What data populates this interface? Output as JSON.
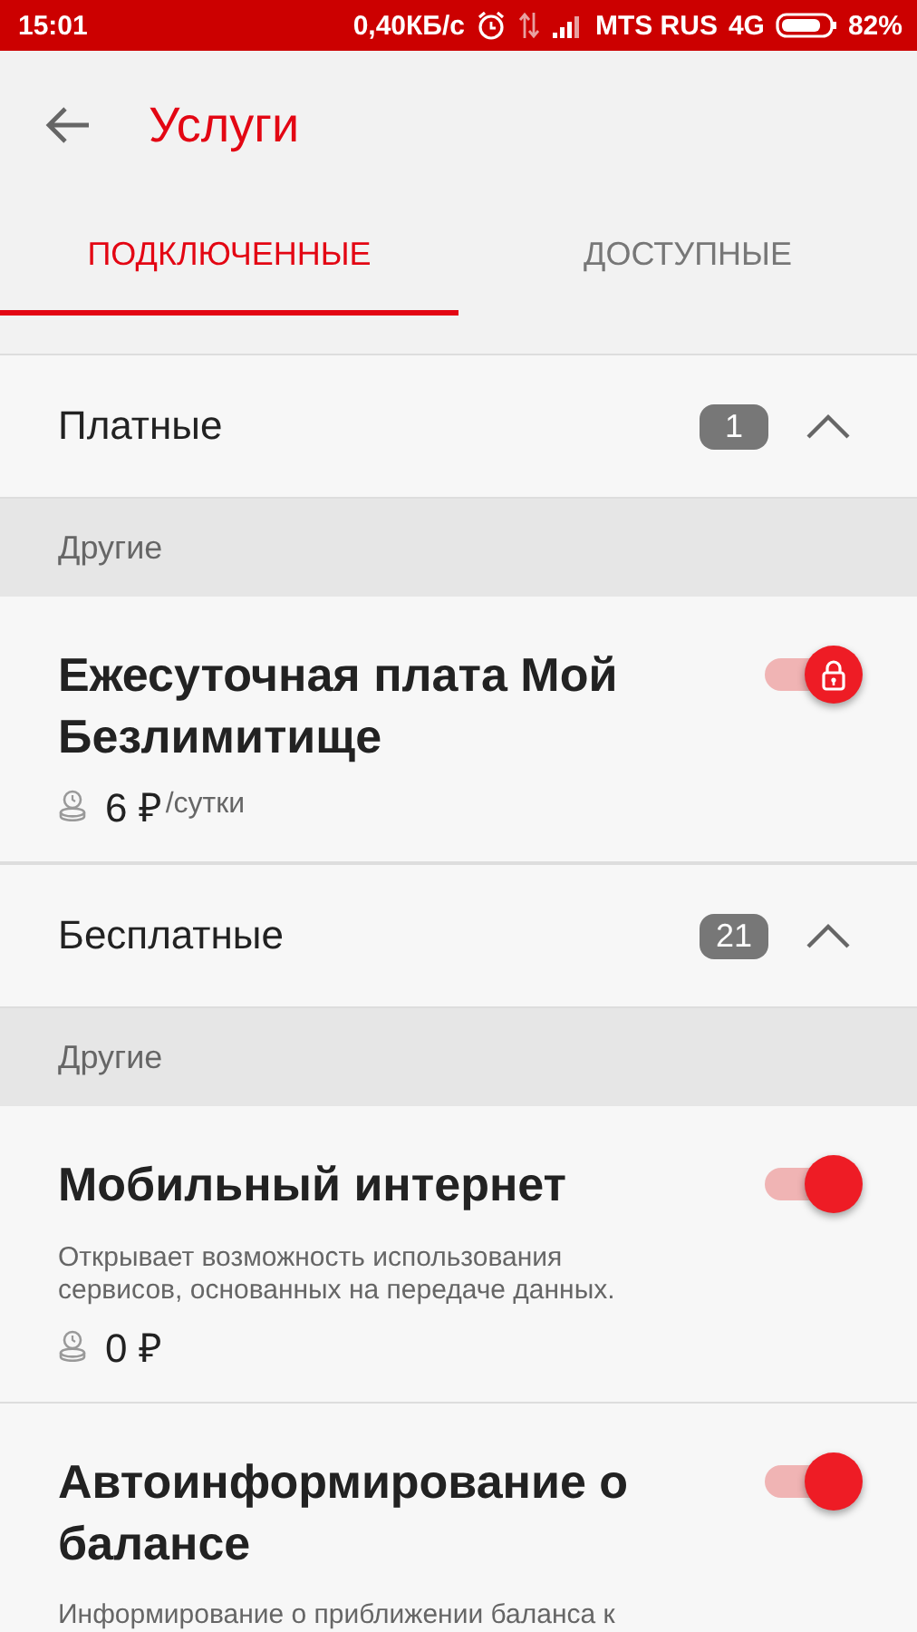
{
  "status_bar": {
    "time": "15:01",
    "speed": "0,40КБ/с",
    "carrier": "MTS RUS",
    "network": "4G",
    "battery": "82%"
  },
  "header": {
    "title": "Услуги"
  },
  "tabs": [
    {
      "label": "ПОДКЛЮЧЕННЫЕ",
      "selected": true
    },
    {
      "label": "ДОСТУПНЫЕ",
      "selected": false
    }
  ],
  "sections": [
    {
      "title": "Платные",
      "count": "1",
      "expanded": true,
      "groups": [
        {
          "title": "Другие",
          "services": [
            {
              "name": "Ежесуточная плата Мой Безлимитище",
              "price": "6 ₽",
              "unit": "/сутки",
              "on": true,
              "locked": true
            }
          ]
        }
      ]
    },
    {
      "title": "Бесплатные",
      "count": "21",
      "expanded": true,
      "groups": [
        {
          "title": "Другие",
          "services": [
            {
              "name": "Мобильный интернет",
              "description": "Открывает возможность использования сервисов, основанных на передаче данных.",
              "price": "0 ₽",
              "on": true,
              "locked": false
            },
            {
              "name": "Автоинформирование о балансе",
              "description": "Информирование о приближении баланса к",
              "on": true,
              "locked": false
            }
          ]
        }
      ]
    }
  ]
}
